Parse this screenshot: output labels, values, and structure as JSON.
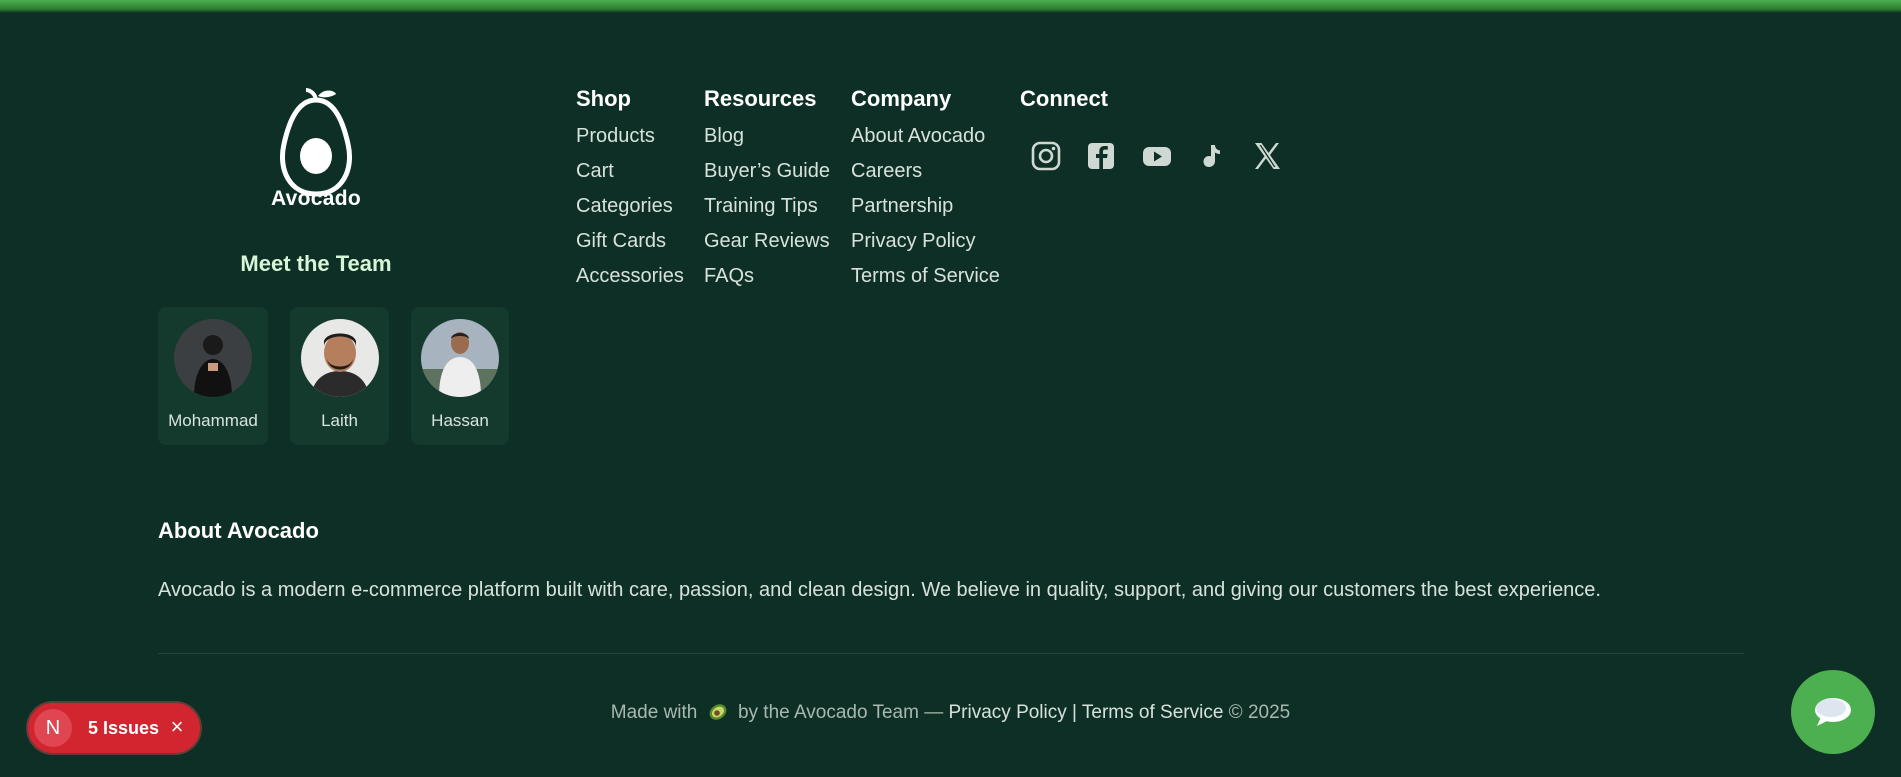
{
  "brand": {
    "name": "Avocado"
  },
  "team": {
    "title": "Meet the Team",
    "members": [
      {
        "name": "Mohammad"
      },
      {
        "name": "Laith"
      },
      {
        "name": "Hassan"
      }
    ]
  },
  "columns": [
    {
      "title": "Shop",
      "links": [
        "Products",
        "Cart",
        "Categories",
        "Gift Cards",
        "Accessories"
      ]
    },
    {
      "title": "Resources",
      "links": [
        "Blog",
        "Buyer’s Guide",
        "Training Tips",
        "Gear Reviews",
        "FAQs"
      ]
    },
    {
      "title": "Company",
      "links": [
        "About Avocado",
        "Careers",
        "Partnership",
        "Privacy Policy",
        "Terms of Service"
      ]
    },
    {
      "title": "Connect"
    }
  ],
  "social": [
    "instagram-icon",
    "facebook-icon",
    "youtube-icon",
    "tiktok-icon",
    "x-icon"
  ],
  "about": {
    "title": "About Avocado",
    "text": "Avocado is a modern e-commerce platform built with care, passion, and clean design. We believe in quality, support, and giving our customers the best experience."
  },
  "bottom": {
    "made_with": "Made with",
    "by_team": "by the Avocado Team —",
    "privacy": "Privacy Policy",
    "sep": "|",
    "terms": "Terms of Service",
    "copyright": "© 2025"
  },
  "issues_badge": {
    "letter": "N",
    "label": "5 Issues",
    "close": "×"
  },
  "colors": {
    "background": "#0e2f25",
    "accent": "#4caf50",
    "badge": "#d1262f"
  }
}
